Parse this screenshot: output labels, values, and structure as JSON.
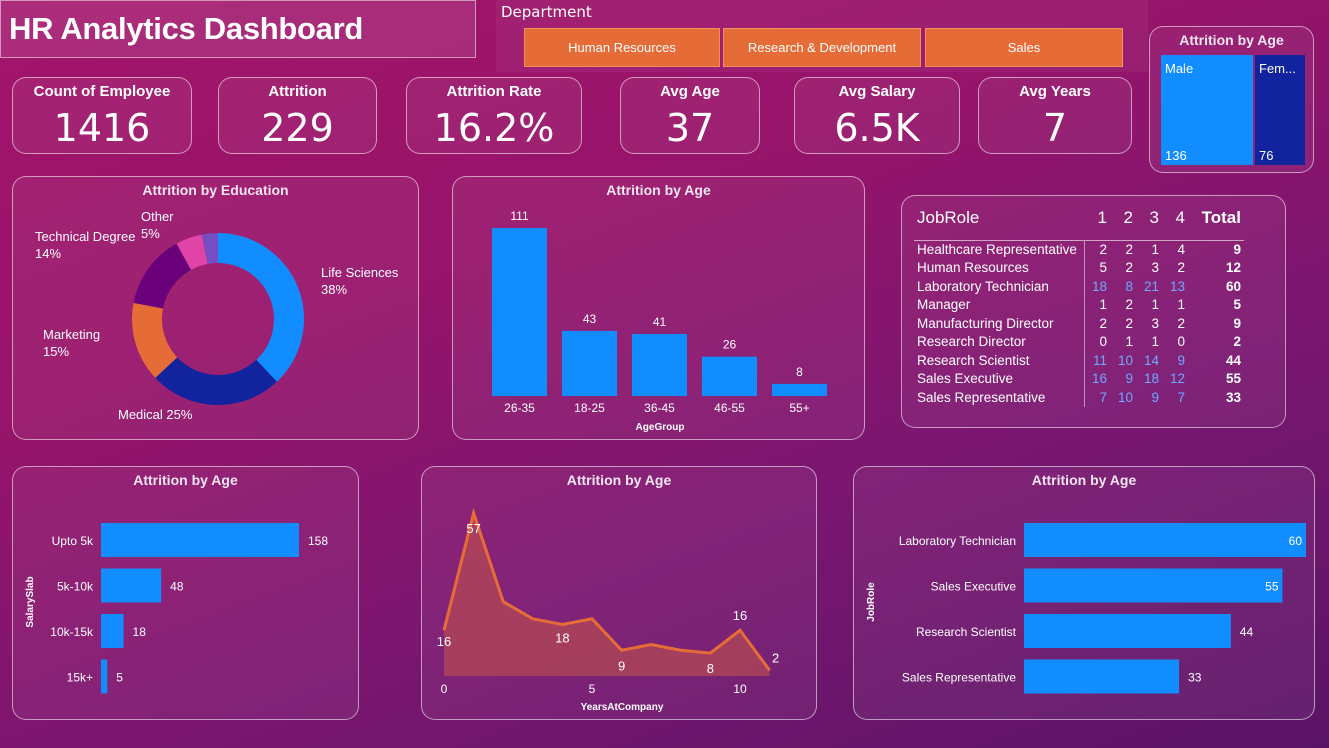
{
  "header": {
    "title": "HR Analytics  Dashboard"
  },
  "slicer": {
    "label": "Department",
    "options": [
      "Human Resources",
      "Research & Development",
      "Sales"
    ]
  },
  "kpis": [
    {
      "title": "Count of Employee",
      "value": "1416"
    },
    {
      "title": "Attrition",
      "value": "229"
    },
    {
      "title": "Attrition Rate",
      "value": "16.2%"
    },
    {
      "title": "Avg Age",
      "value": "37"
    },
    {
      "title": "Avg Salary",
      "value": "6.5K"
    },
    {
      "title": "Avg Years",
      "value": "7"
    }
  ],
  "colors": {
    "blue": "#118DFF",
    "navy": "#12239E",
    "orange": "#E66C37",
    "purple": "#6B007B",
    "pink": "#E044A7",
    "violet": "#744EC2"
  },
  "chart_data": [
    {
      "type": "treemap",
      "title": "Attrition by Age",
      "categories": [
        "Male",
        "Fem..."
      ],
      "values": [
        136,
        76
      ]
    },
    {
      "type": "pie",
      "title": "Attrition by Education",
      "categories": [
        "Life Sciences",
        "Medical",
        "Marketing",
        "Technical Degree",
        "Other",
        ""
      ],
      "values": [
        38,
        25,
        15,
        14,
        5,
        3
      ],
      "labels": [
        "Life Sciences\n38%",
        "Medical 25%",
        "Marketing\n15%",
        "Technical Degree\n14%",
        "Other\n5%",
        ""
      ]
    },
    {
      "type": "bar",
      "title": "Attrition by Age",
      "xlabel": "AgeGroup",
      "categories": [
        "26-35",
        "18-25",
        "36-45",
        "46-55",
        "55+"
      ],
      "values": [
        111,
        43,
        41,
        26,
        8
      ]
    },
    {
      "type": "table",
      "columns": [
        "JobRole",
        "1",
        "2",
        "3",
        "4",
        "Total"
      ],
      "rows": [
        [
          "Healthcare Representative",
          2,
          2,
          1,
          4,
          9
        ],
        [
          "Human Resources",
          5,
          2,
          3,
          2,
          12
        ],
        [
          "Laboratory Technician",
          18,
          8,
          21,
          13,
          60
        ],
        [
          "Manager",
          1,
          2,
          1,
          1,
          5
        ],
        [
          "Manufacturing Director",
          2,
          2,
          3,
          2,
          9
        ],
        [
          "Research Director",
          0,
          1,
          1,
          0,
          2
        ],
        [
          "Research Scientist",
          11,
          10,
          14,
          9,
          44
        ],
        [
          "Sales Executive",
          16,
          9,
          18,
          12,
          55
        ],
        [
          "Sales Representative",
          7,
          10,
          9,
          7,
          33
        ]
      ]
    },
    {
      "type": "bar",
      "orientation": "horizontal",
      "title": "Attrition by Age",
      "ylabel": "SalarySlab",
      "categories": [
        "Upto 5k",
        "5k-10k",
        "10k-15k",
        "15k+"
      ],
      "values": [
        158,
        48,
        18,
        5
      ]
    },
    {
      "type": "area",
      "title": "Attrition by Age",
      "xlabel": "YearsAtCompany",
      "x": [
        0,
        1,
        2,
        3,
        4,
        5,
        6,
        7,
        8,
        9,
        10,
        11
      ],
      "values": [
        16,
        57,
        26,
        20,
        18,
        20,
        9,
        11,
        9,
        8,
        16,
        2
      ],
      "data_labels": {
        "0": "16",
        "1": "57",
        "4": "18",
        "6": "9",
        "9": "8",
        "10": "16",
        "11": "2"
      },
      "xticks": [
        0,
        5,
        10
      ]
    },
    {
      "type": "bar",
      "orientation": "horizontal",
      "title": "Attrition by Age",
      "ylabel": "JobRole",
      "categories": [
        "Laboratory Technician",
        "Sales Executive",
        "Research Scientist",
        "Sales Representative"
      ],
      "values": [
        60,
        55,
        44,
        33
      ]
    }
  ]
}
